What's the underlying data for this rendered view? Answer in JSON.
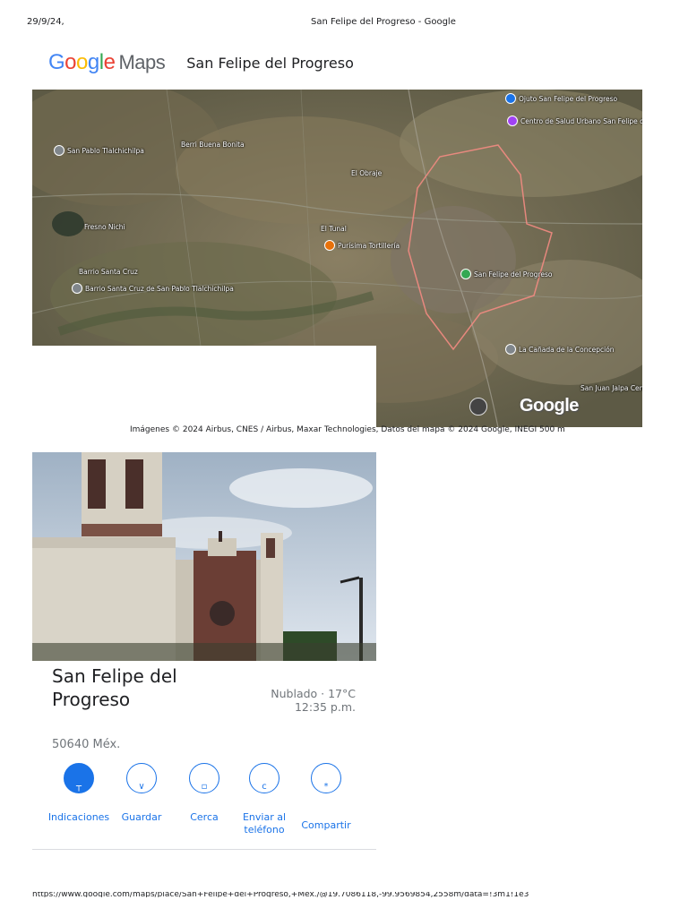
{
  "print": {
    "date": "29/9/24,",
    "title": "San Felipe del Progreso - Google"
  },
  "header": {
    "logo_google": "Google",
    "logo_maps": "Maps",
    "place": "San Felipe del Progreso"
  },
  "map": {
    "pins": [
      {
        "label": "Ojuto San Felipe del Progreso",
        "color": "#1a73e8"
      },
      {
        "label": "Centro de Salud Urbano San Felipe del Progreso",
        "color": "#a142f4"
      },
      {
        "label": "San Pablo Tlalchichilpa",
        "color": "#80868b"
      },
      {
        "label": "Barrio Santa Cruz de San Pablo Tlalchichilpa",
        "color": "#80868b"
      },
      {
        "label": "Purísima Tortillería",
        "color": "#e8710a"
      },
      {
        "label": "San Felipe del Progreso",
        "color": "#34a853"
      },
      {
        "label": "La Cañada de la Concepción",
        "color": "#80868b"
      }
    ],
    "areas": [
      "Berri Buena Bonita",
      "El Obraje",
      "Barrio Santa Cruz",
      "El Tunal",
      "San Juan Jalpa Centro",
      "Fresno Nichi"
    ],
    "google_mark": "Google",
    "attribution": "Imágenes © 2024 Airbus, CNES / Airbus, Maxar Technologies, Datos del mapa © 2024 Google, INEGI    500 m"
  },
  "place": {
    "name": "San Felipe del Progreso",
    "address": "50640 Méx.",
    "weather": "Nublado · 17°C",
    "time": "12:35 p.m."
  },
  "actions": [
    {
      "label": "Indicaciones",
      "icon": "directions-icon"
    },
    {
      "label": "Guardar",
      "icon": "bookmark-icon"
    },
    {
      "label": "Cerca",
      "icon": "nearby-icon"
    },
    {
      "label": "Enviar al teléfono",
      "icon": "send-to-phone-icon"
    },
    {
      "label": "Compartir",
      "icon": "share-icon"
    }
  ],
  "footer": {
    "url": "https://www.google.com/maps/place/San+Felipe+del+Progreso,+Méx./@19.7086118,-99.9569854,2558m/data=!3m1!1e3"
  },
  "colors": {
    "accent": "#1a73e8",
    "boundary": "#f28b82"
  }
}
